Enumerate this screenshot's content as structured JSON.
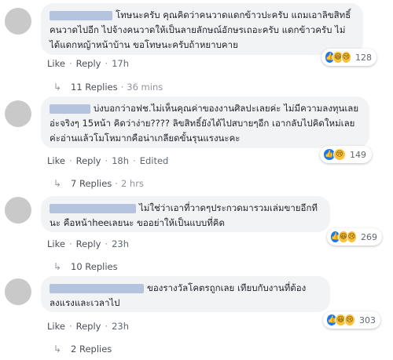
{
  "comments": [
    {
      "text": "โทษนะครับ คุณคิดว่าคนวาดแดกข้าวปะครับ แถมเอาลิขสิทธิ์คนวาดไปอีก ไปจ้างคนวาดให้เป็นลายลักษณ์อักษรเถอะครับ แดกข้าวครับ ไม่ได้แดกหญ้าหน้าบ้าน ขอโทษนะครับถ้าหยาบคาย",
      "reaction_icons": [
        "like-icon",
        "haha-icon",
        "sad-icon"
      ],
      "reaction_count": "128",
      "like": "Like",
      "reply": "Reply",
      "time": "17h",
      "edited": "",
      "replies_count": "11 Replies",
      "replies_time": "36 mins"
    },
    {
      "text": "บ่งบอกว่าอฟช.ไม่เห็นคุณค่าของงานศิลปะเลยค่ะ ไม่มีความลงทุนเลยอ่ะจริงๆ 15หน้า คิดว่าง่าย???? ลิขสิทธิ์ยังได้ไปสบายๆอีก เอากลับไปคิดใหม่เลยค่ะอ่านแล้วโมโหมากคือน่าเกลียดขั้นรุนแรงนะคะ",
      "reaction_icons": [
        "like-icon",
        "sad-icon"
      ],
      "reaction_count": "149",
      "like": "Like",
      "reply": "Reply",
      "time": "18h",
      "edited": "Edited",
      "replies_count": "7 Replies",
      "replies_time": "2 hrs"
    },
    {
      "text": "ไม่ใช่ว่าเอาที่วาดๆประกวดมารวมเล่มขายอีกทีนะ คือหน้าheeเลยนะ ขออย่าให้เป็นแบบที่คิด",
      "reaction_icons": [
        "like-icon",
        "haha-icon",
        "sad-icon"
      ],
      "reaction_count": "269",
      "like": "Like",
      "reply": "Reply",
      "time": "23h",
      "edited": "",
      "replies_count": "10 Replies",
      "replies_time": ""
    },
    {
      "text": "ของรางวัลโคตรถูกเลย เทียบกับงานที่ต้องลงแรงและเวลาไป",
      "reaction_icons": [
        "like-icon",
        "haha-icon",
        "sad-icon"
      ],
      "reaction_count": "303",
      "like": "Like",
      "reply": "Reply",
      "time": "23h",
      "edited": "",
      "replies_count": "2 Replies",
      "replies_time": ""
    }
  ]
}
